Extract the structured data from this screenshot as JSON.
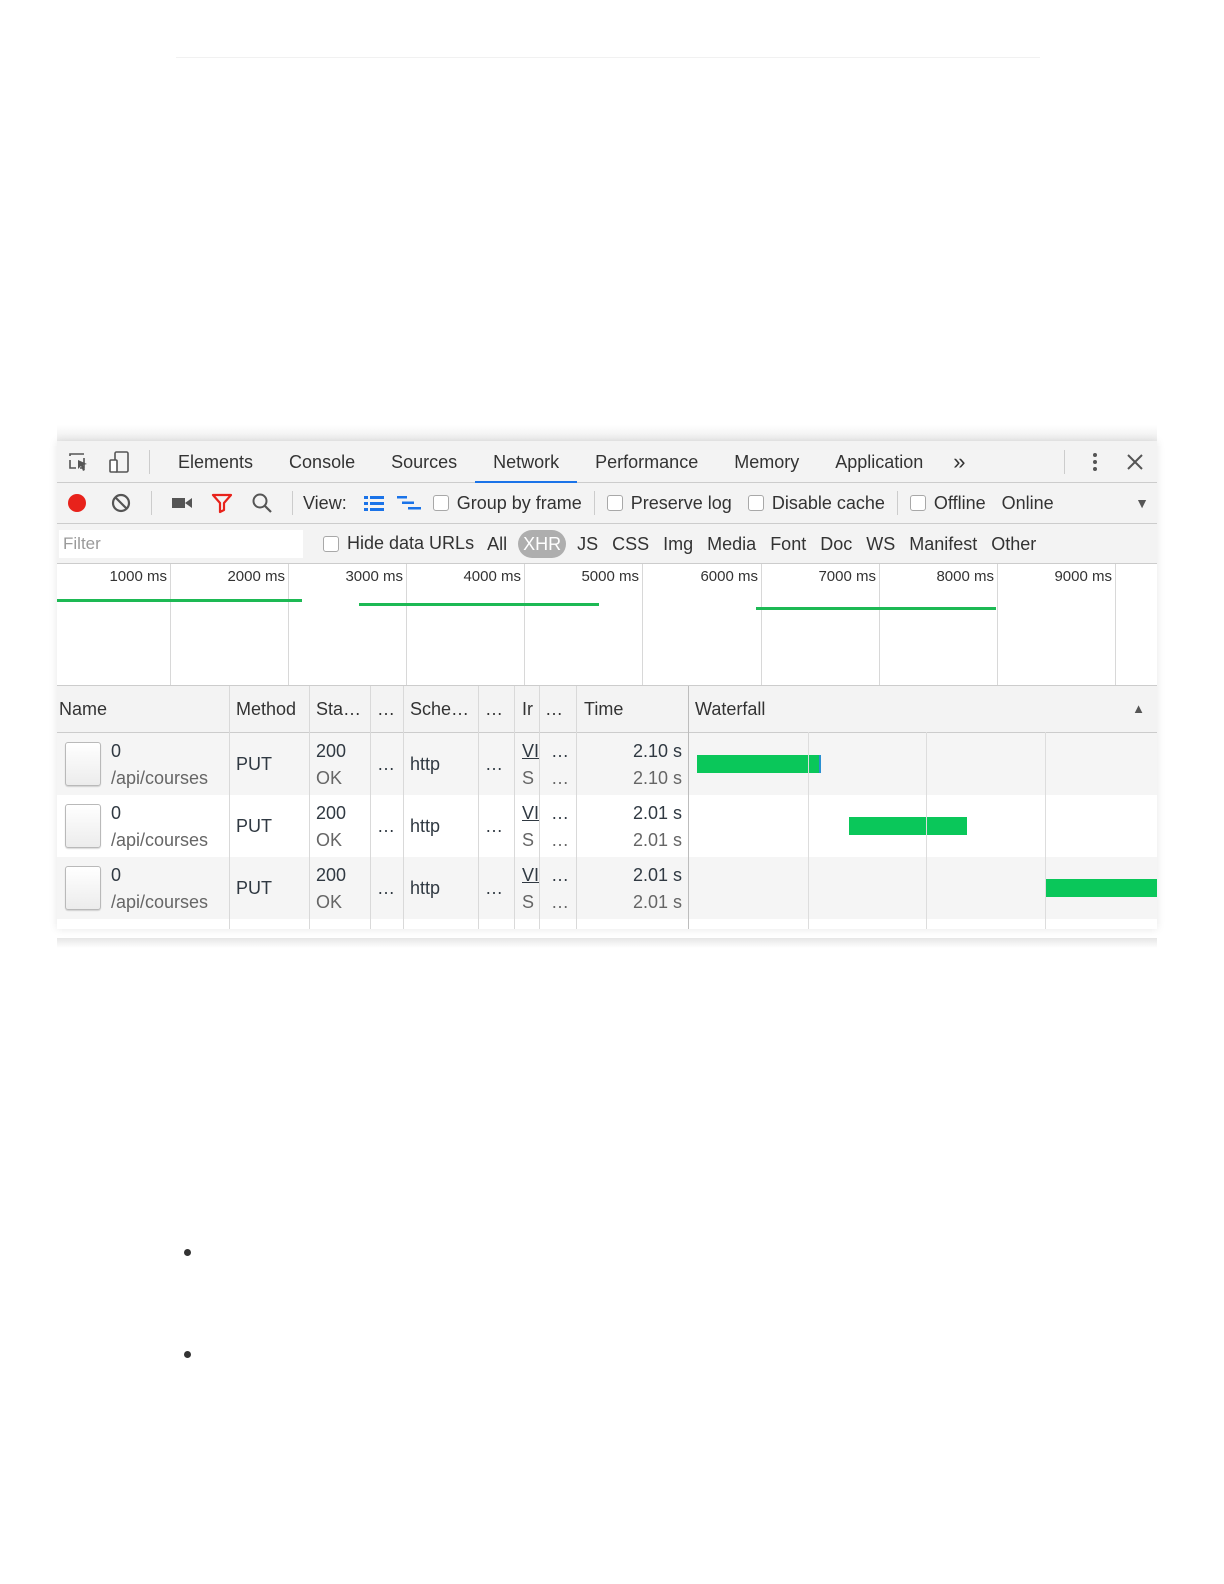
{
  "devtools": {
    "tabs": [
      "Elements",
      "Console",
      "Sources",
      "Network",
      "Performance",
      "Memory",
      "Application"
    ],
    "active_tab": "Network",
    "more_tabs": "»",
    "toolbar": {
      "view_label": "View:",
      "group_by_frame": "Group by frame",
      "preserve_log": "Preserve log",
      "disable_cache": "Disable cache",
      "offline": "Offline",
      "throttling": "Online"
    },
    "filter": {
      "placeholder": "Filter",
      "hide_data_urls": "Hide data URLs",
      "types": [
        "All",
        "XHR",
        "JS",
        "CSS",
        "Img",
        "Media",
        "Font",
        "Doc",
        "WS",
        "Manifest",
        "Other"
      ],
      "active_type": "XHR"
    },
    "overview": {
      "ticks": [
        "1000 ms",
        "2000 ms",
        "3000 ms",
        "4000 ms",
        "5000 ms",
        "6000 ms",
        "7000 ms",
        "8000 ms",
        "9000 ms"
      ]
    },
    "table": {
      "columns": [
        "Name",
        "Method",
        "Sta…",
        "…",
        "Sche…",
        "…",
        "Ir",
        "…",
        "Time",
        "Waterfall"
      ],
      "rows": [
        {
          "name": "0",
          "path": "/api/courses",
          "method": "PUT",
          "status": "200",
          "status_text": "OK",
          "c1": "…",
          "scheme": "http",
          "c2": "…",
          "initiator": "VI",
          "initiator_sub": "S",
          "c3": "…",
          "c3_sub": "…",
          "time": "2.10 s",
          "latency": "2.10 s"
        },
        {
          "name": "0",
          "path": "/api/courses",
          "method": "PUT",
          "status": "200",
          "status_text": "OK",
          "c1": "…",
          "scheme": "http",
          "c2": "…",
          "initiator": "VI",
          "initiator_sub": "S",
          "c3": "…",
          "c3_sub": "…",
          "time": "2.01 s",
          "latency": "2.01 s"
        },
        {
          "name": "0",
          "path": "/api/courses",
          "method": "PUT",
          "status": "200",
          "status_text": "OK",
          "c1": "…",
          "scheme": "http",
          "c2": "…",
          "initiator": "VI",
          "initiator_sub": "S",
          "c3": "…",
          "c3_sub": "…",
          "time": "2.01 s",
          "latency": "2.01 s"
        }
      ]
    },
    "colors": {
      "record": "#e8221b",
      "accent": "#1a73e8",
      "waterfall": "#0ac75a"
    }
  }
}
